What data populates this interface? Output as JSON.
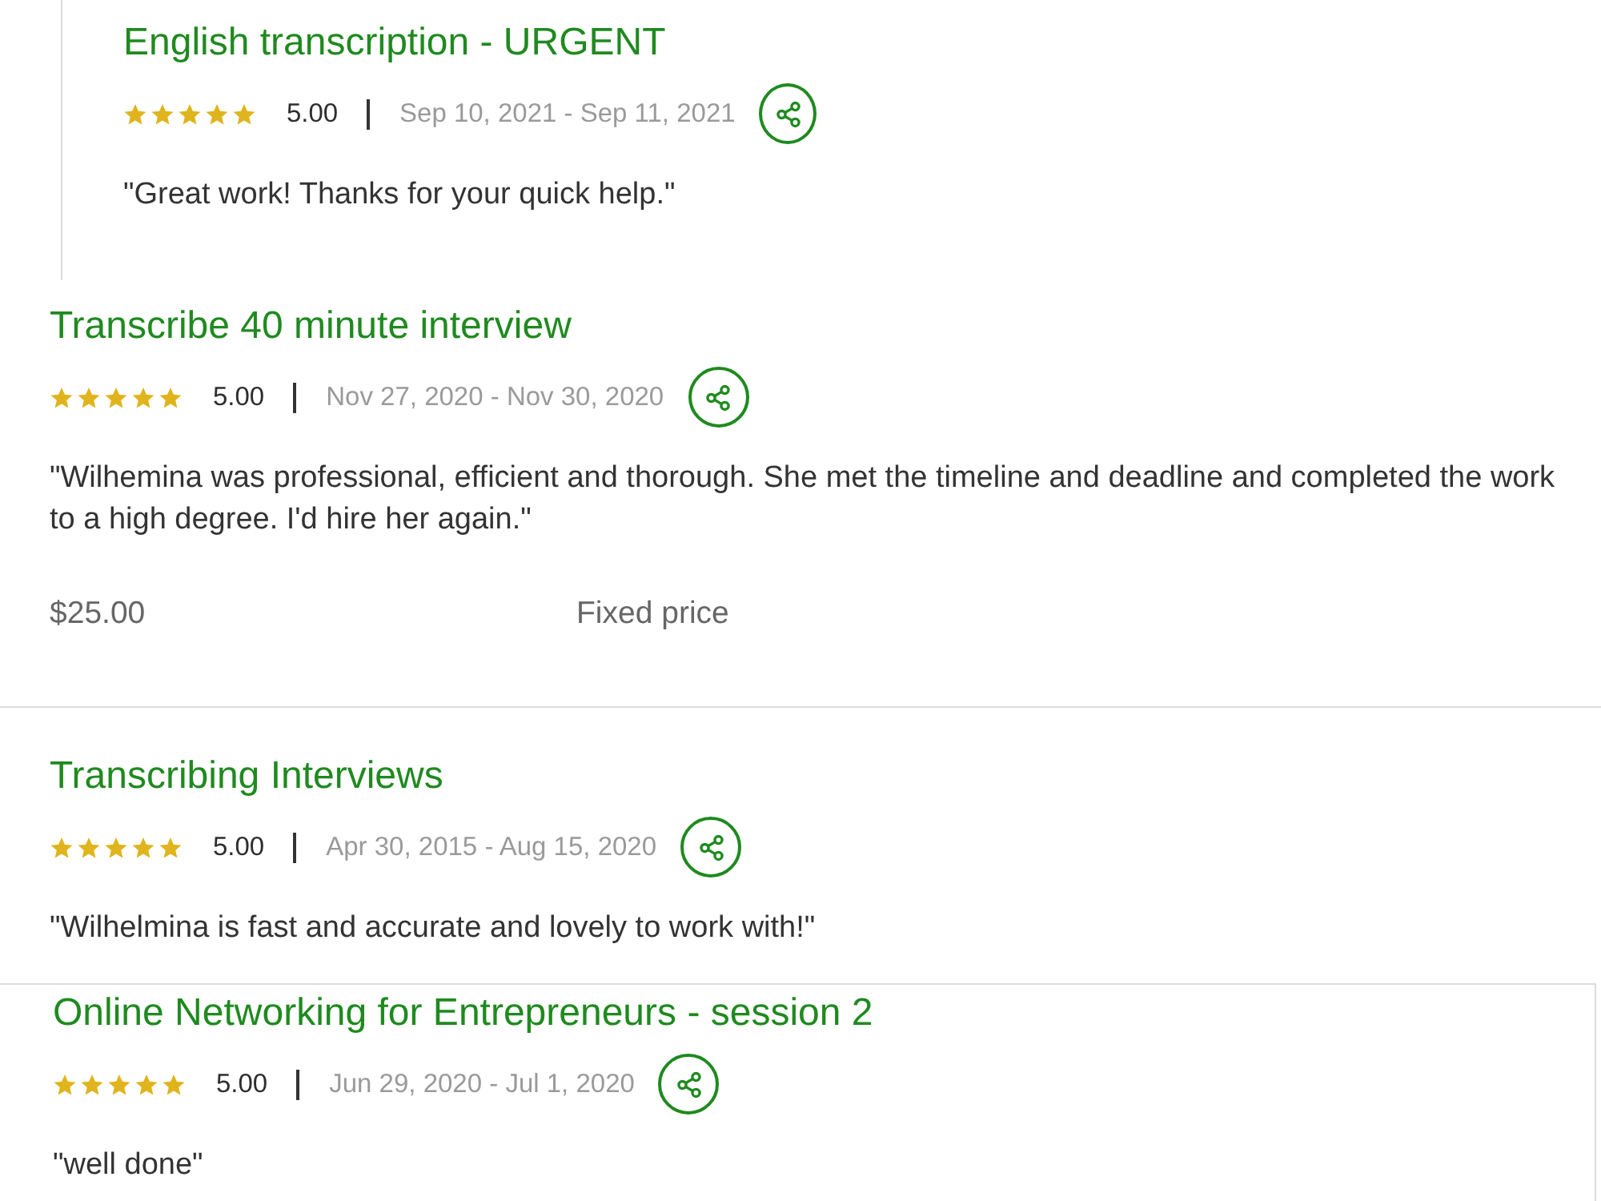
{
  "reviews": [
    {
      "title": "English transcription - URGENT",
      "stars": 5,
      "rating": "5.00",
      "dates": "Sep 10, 2021 - Sep 11, 2021",
      "quote": "\"Great work! Thanks for your quick help.\""
    },
    {
      "title": "Transcribe 40 minute interview",
      "stars": 5,
      "rating": "5.00",
      "dates": "Nov 27, 2020 - Nov 30, 2020",
      "quote": "\"Wilhemina was professional, efficient and thorough. She met the timeline and deadline and completed the work to a high degree. I'd hire her again.\"",
      "price": "$25.00",
      "price_type": "Fixed price"
    },
    {
      "title": "Transcribing Interviews",
      "stars": 5,
      "rating": "5.00",
      "dates": "Apr 30, 2015 - Aug 15, 2020",
      "quote": "\"Wilhelmina is fast and accurate and lovely to work with!\""
    },
    {
      "title": "Online Networking for Entrepreneurs - session 2",
      "stars": 5,
      "rating": "5.00",
      "dates": "Jun 29, 2020 - Jul 1, 2020",
      "quote": "\"well done\""
    }
  ]
}
